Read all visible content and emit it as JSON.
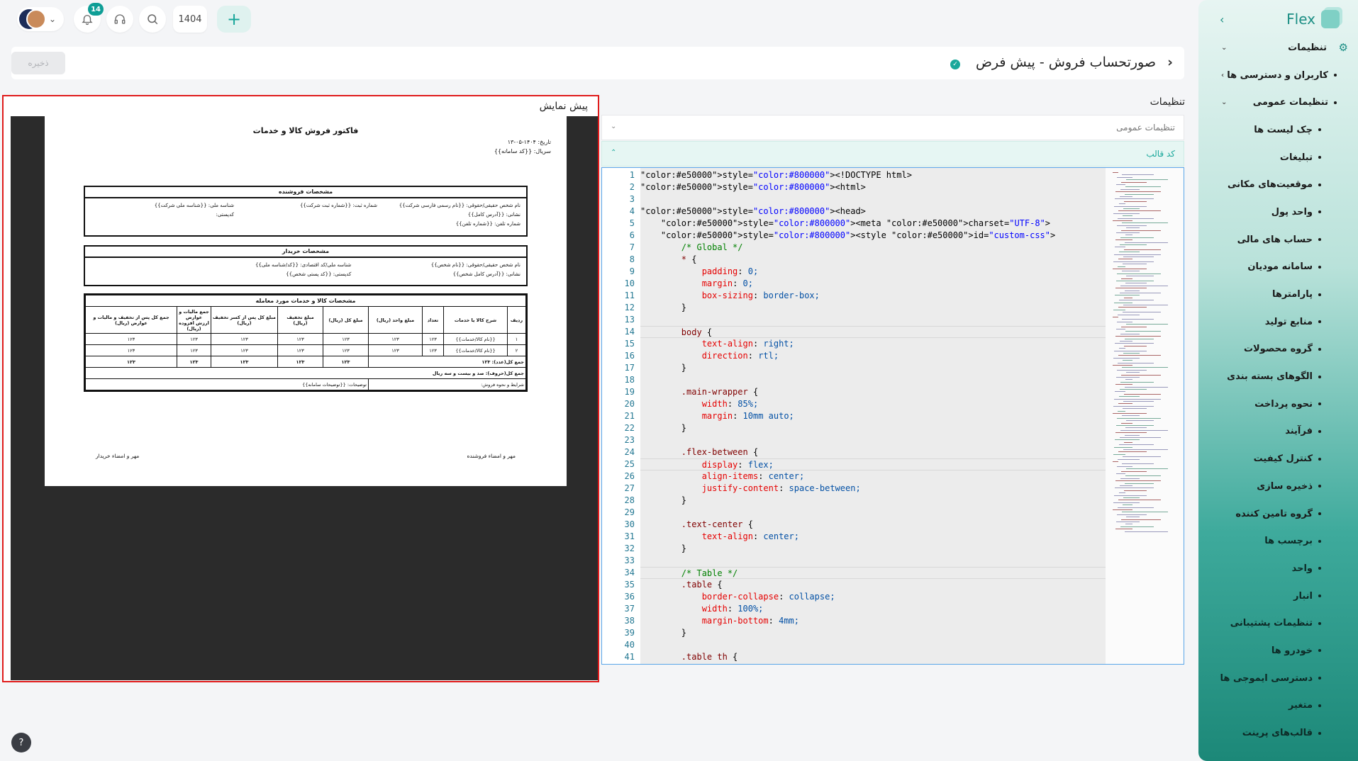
{
  "topbar": {
    "notifications_count": "14",
    "year": "1404",
    "add_symbol": "+"
  },
  "header": {
    "title": "صورتحساب فروش - پیش فرض",
    "save_label": "ذخیره"
  },
  "preview": {
    "title": "پیش نمایش",
    "invoice": {
      "title": "فاکتور فروش کالا و خدمات",
      "date": "تاریخ: ۱۴۰۴-۰۵-۱۳",
      "serial": "سریال: {{کد سامانه}}",
      "seller": {
        "header": "مشخصات فروشنده",
        "name": "نام شخص حقیقی/حقوقی: {{نام رسمی فارسی شرکت}}",
        "reg": "شماره ثبت: {{شماره ثبت شرکت}}",
        "national": "شناسه ملی: {{شناسه ملی شرکت}}",
        "address": "نشانی: {{آدرس کامل}}",
        "postal": "کدپستی:",
        "phone": "شماره تلفن: {{شماره تلفن}}"
      },
      "buyer": {
        "header": "مشخصات خریدار",
        "name": "نام شخص حقیقی/حقوقی: {{نام شخص}}",
        "national": "شناسه ملی/کد اقتصادی: {{کد/شناسه ملی}}",
        "address": "نشانی: {{آدرس کامل شخص}}",
        "postal": "کدپستی: {{کد پستی شخص}}"
      },
      "items_header": "مشخصات کالا و خدمات مورد معامله",
      "columns": [
        "ردیف",
        "شرح کالا یا خدمات",
        "تعداد",
        "مبلغ واحد (ریال)",
        "مبلغ کل (ریال)",
        "مبلغ تخفیف (ریال)",
        "مبلغ کل پس از کسر تخفیف (ریال)",
        "جمع مالیات و عوارض ارزش افزوده (ریال)",
        "جمع کل پس از تخفیف و مالیات و عوارض (ریال)"
      ],
      "rows": [
        [
          "۱",
          "{{نام کالا/خدمات}}",
          "۱۲۳",
          "۱۲۳",
          "۱۲۳",
          "۱۲۳",
          "۱۲۳",
          "۱۲۳",
          "۱۲۳"
        ],
        [
          "۲",
          "{{نام کالا/خدمات}}",
          "۱۲۳",
          "۱۲۳",
          "۱۲۳",
          "۱۲۳",
          "۱۲۳",
          "۱۲۳",
          "۱۲۳"
        ]
      ],
      "sum_label": "جمع کل(عدد): ۱۲۳",
      "sum_values": [
        "۱۲۳",
        "۱۲۳",
        "۱۲۳",
        "۱۲۳",
        "۱۲۳"
      ],
      "sum_words": "جمع کل(حروف): صد و بیست و سه ریال",
      "terms": "شرایط و نحوه فروش:",
      "notes": "توضیحات: {{توضیحات سامانه}}",
      "seller_sign": "مهر و امضاء فروشنده",
      "buyer_sign": "مهر و امضاء خریدار"
    }
  },
  "settings": {
    "title": "تنظیمات",
    "general_label": "تنظیمات عمومی",
    "template_label": "کد قالب"
  },
  "editor": {
    "lines": [
      "<!DOCTYPE html>",
      "<html>",
      "",
      "<head>",
      "    <meta charset=\"UTF-8\">",
      "    <style id=\"custom-css\">",
      "        /* Global */",
      "        * {",
      "            padding: 0;",
      "            margin: 0;",
      "            box-sizing: border-box;",
      "        }",
      "",
      "        body {",
      "            text-align: right;",
      "            direction: rtl;",
      "        }",
      "",
      "        .main-wrapper {",
      "            width: 85%;",
      "            margin: 10mm auto;",
      "        }",
      "",
      "        .flex-between {",
      "            display: flex;",
      "            align-items: center;",
      "            justify-content: space-between;",
      "        }",
      "",
      "        .text-center {",
      "            text-align: center;",
      "        }",
      "",
      "        /* Table */",
      "        .table {",
      "            border-collapse: collapse;",
      "            width: 100%;",
      "            margin-bottom: 4mm;",
      "        }",
      "",
      "        .table th {"
    ]
  },
  "sidebar": {
    "brand": "Flex",
    "settings_label": "تنظیمات",
    "users_label": "کاربران و دسترسی ها",
    "general_label": "تنظیمات عمومی",
    "items": [
      "چک لیست ها",
      "تبلیغات",
      "موقعیت‌های مکانی",
      "واحد پول",
      "حساب های مالی",
      "سامانه مودیان",
      "پارامترها",
      "منابع تولید",
      "گروه محصولات",
      "الگوهای بسته بندی",
      "نحوه پرداخت",
      "فرآیند",
      "کنترل کیفیت",
      "ذخیره سازی",
      "گروه تامین کننده",
      "برچسب ها",
      "واحد",
      "انبار",
      "تنظیمات پشتیبانی",
      "خودرو ها",
      "دسترسی ایموجی ها",
      "متغیر",
      "قالب‌های پرینت"
    ]
  },
  "help_label": "?"
}
